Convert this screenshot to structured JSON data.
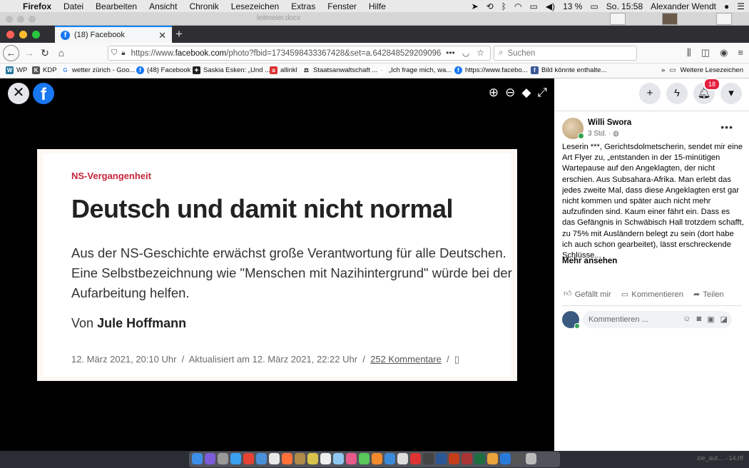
{
  "menubar": {
    "items": [
      "Firefox",
      "Datei",
      "Bearbeiten",
      "Ansicht",
      "Chronik",
      "Lesezeichen",
      "Extras",
      "Fenster",
      "Hilfe"
    ],
    "battery": "13 %",
    "clock": "So. 15:58",
    "user": "Alexander Wendt"
  },
  "background_window": {
    "doc_title": "leitmeier.docx"
  },
  "tab": {
    "title": "(18) Facebook"
  },
  "navbar": {
    "url_prefix": "https://www.",
    "url_domain": "facebook.com",
    "url_rest": "/photo?fbid=1734598433367428&set=a.642848529209096",
    "search_placeholder": "Suchen"
  },
  "bookmarks": {
    "items": [
      "WP",
      "KDP",
      "wetter zürich - Goo...",
      "(48) Facebook",
      "Saskia Esken: „Und ...",
      "allinkl",
      "Staatsanwaltschaft ...",
      "„Ich frage mich, wa...",
      "https://www.facebo...",
      "Bild könnte enthalte..."
    ],
    "more": "Weitere Lesezeichen"
  },
  "article": {
    "kicker": "NS-Vergangenheit",
    "headline": "Deutsch und damit nicht normal",
    "teaser": "Aus der NS-Geschichte erwächst große Verantwortung für alle Deutschen. Eine Selbstbezeichnung wie \"Menschen mit Nazihintergrund\" würde bei der Aufarbeitung helfen.",
    "byline_prefix": "Von",
    "author": "Jule Hoffmann",
    "date": "12. März 2021, 20:10 Uhr",
    "updated": "Aktualisiert am 12. März 2021, 22:22 Uhr",
    "comments": "252 Kommentare"
  },
  "panel": {
    "notifications_badge": "18",
    "author": "Willi Swora",
    "time": "3 Std. · ",
    "post_text": "Leserin ***, Gerichtsdolmetscherin, sendet mir eine Art Flyer zu, „entstanden in der 15-minütigen Wartepause auf den Angeklagten, der nicht erschien. Aus Subsahara-Afrika. Man erlebt das jedes zweite Mal, dass diese Angeklagten erst gar nicht kommen und später auch nicht mehr aufzufinden sind. Kaum einer fährt ein. Dass es das Gefängnis in Schwäbisch Hall trotzdem schafft, zu 75% mit Ausländern belegt zu sein (dort habe ich auch schon gearbeitet), lässt erschreckende Schlüsse...",
    "see_more": "Mehr ansehen",
    "like": "Gefällt mir",
    "comment": "Kommentieren",
    "share": "Teilen",
    "comment_placeholder": "Kommentieren ..."
  },
  "dock": {
    "label": "zie_aut.....-14.rtf"
  }
}
